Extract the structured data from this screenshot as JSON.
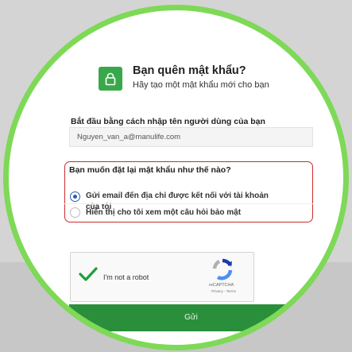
{
  "header": {
    "title": "Bạn quên mật khẩu?",
    "subtitle": "Hãy tạo một mật khẩu mới cho bạn",
    "icon": "lock-icon"
  },
  "username": {
    "label": "Bắt đầu bằng cách nhập tên người dùng của bạn",
    "value": "Nguyen_van_a@manulife.com"
  },
  "reset_method": {
    "question": "Bạn muốn đặt lại mật khẩu như thế nào?",
    "options": [
      {
        "line1": "Gửi email đến địa chỉ được kết nối với tài khoản",
        "line2": "của tôi",
        "selected": true
      },
      {
        "line1": "Hiển thị cho tôi xem một câu hỏi bảo mật",
        "selected": false
      }
    ]
  },
  "captcha": {
    "label": "I'm not a robot",
    "brand": "reCAPTCHA",
    "links": "Privacy - Terms",
    "checked": true
  },
  "submit": {
    "label": "Gửi"
  },
  "colors": {
    "accent": "#39a84a",
    "button": "#2a8f3a",
    "highlight_border": "#cc2b2b",
    "radio": "#2a5eb7",
    "ring": "#7ed957"
  }
}
